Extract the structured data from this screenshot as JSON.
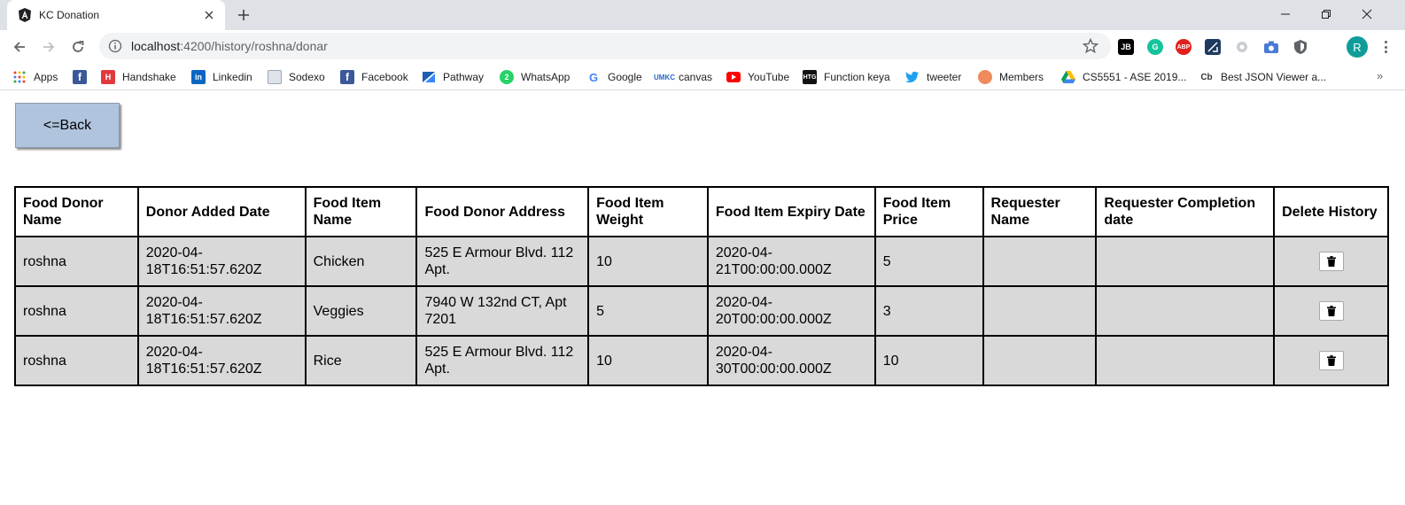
{
  "browser": {
    "tab_title": "KC Donation",
    "url_host": "localhost",
    "url_path": ":4200/history/roshna/donar",
    "profile_initial": "R",
    "extensions": [
      "JB",
      "G",
      "ABP"
    ],
    "bookmarks": [
      {
        "label": "Apps",
        "icon": "apps-grid-icon"
      },
      {
        "label": "",
        "icon": "facebook-icon"
      },
      {
        "label": "Handshake",
        "icon": "handshake-icon"
      },
      {
        "label": "Linkedin",
        "icon": "linkedin-icon"
      },
      {
        "label": "Sodexo",
        "icon": "document-icon"
      },
      {
        "label": "Facebook",
        "icon": "facebook-icon"
      },
      {
        "label": "Pathway",
        "icon": "pathway-icon"
      },
      {
        "label": "WhatsApp",
        "icon": "whatsapp-icon"
      },
      {
        "label": "Google",
        "icon": "google-icon"
      },
      {
        "label": "canvas",
        "icon": "umkc-icon"
      },
      {
        "label": "YouTube",
        "icon": "youtube-icon"
      },
      {
        "label": "Function keya",
        "icon": "htg-icon"
      },
      {
        "label": "tweeter",
        "icon": "twitter-icon"
      },
      {
        "label": "Members",
        "icon": "members-icon"
      },
      {
        "label": "CS5551 - ASE 2019...",
        "icon": "google-drive-icon"
      },
      {
        "label": "Best JSON Viewer a...",
        "icon": "cb-icon"
      }
    ]
  },
  "page": {
    "back_label": "<=Back",
    "table": {
      "headers": [
        "Food Donor Name",
        "Donor Added Date",
        "Food Item Name",
        "Food Donor Address",
        "Food Item Weight",
        "Food Item Expiry Date",
        "Food Item Price",
        "Requester Name",
        "Requester Completion date",
        "Delete History"
      ],
      "rows": [
        [
          "roshna",
          "2020-04-18T16:51:57.620Z",
          "Chicken",
          "525 E Armour Blvd. 112 Apt.",
          "10",
          "2020-04-21T00:00:00.000Z",
          "5",
          "",
          ""
        ],
        [
          "roshna",
          "2020-04-18T16:51:57.620Z",
          "Veggies",
          "7940 W 132nd CT, Apt 7201",
          "5",
          "2020-04-20T00:00:00.000Z",
          "3",
          "",
          ""
        ],
        [
          "roshna",
          "2020-04-18T16:51:57.620Z",
          "Rice",
          "525 E Armour Blvd. 112 Apt.",
          "10",
          "2020-04-30T00:00:00.000Z",
          "10",
          "",
          ""
        ]
      ]
    }
  }
}
